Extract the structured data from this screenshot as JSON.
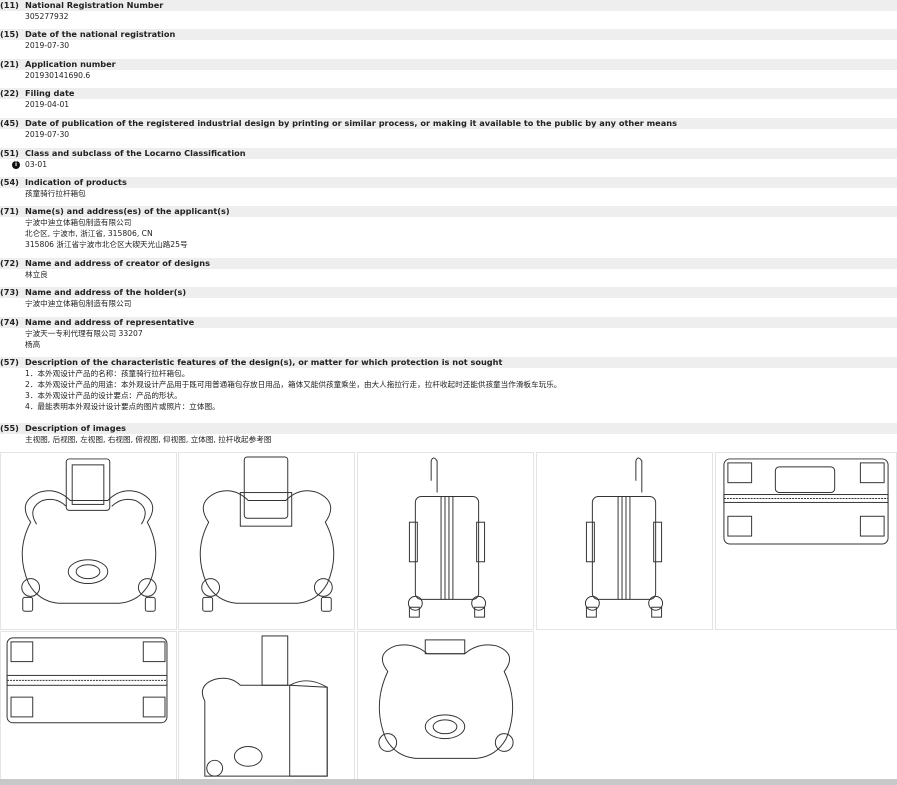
{
  "records": [
    {
      "code": "(11)",
      "label": "National Registration Number",
      "values": [
        "305277932"
      ]
    },
    {
      "code": "(15)",
      "label": "Date of the national registration",
      "values": [
        "2019-07-30"
      ]
    },
    {
      "code": "(21)",
      "label": "Application number",
      "values": [
        "201930141690.6"
      ]
    },
    {
      "code": "(22)",
      "label": "Filing date",
      "values": [
        "2019-04-01"
      ]
    },
    {
      "code": "(45)",
      "label": "Date of publication of the registered industrial design by printing or similar process, or making it available to the public by any other means",
      "values": [
        "2019-07-30"
      ]
    },
    {
      "code": "(51)",
      "label": "Class and subclass of the Locarno Classification",
      "values": [
        "03-01"
      ],
      "icon": "info-icon",
      "icon_glyph": "i"
    },
    {
      "code": "(54)",
      "label": "Indication of products",
      "values": [
        "孩童骑行拉杆箱包"
      ]
    },
    {
      "code": "(71)",
      "label": "Name(s) and address(es) of the applicant(s)",
      "values": [
        "宁波中迪立体箱包制造有限公司",
        "北仑区, 宁波市, 浙江省, 315806, CN",
        "315806 浙江省宁波市北仑区大碶天光山路25号"
      ]
    },
    {
      "code": "(72)",
      "label": "Name and address of creator of designs",
      "values": [
        "林立良"
      ]
    },
    {
      "code": "(73)",
      "label": "Name and address of the holder(s)",
      "values": [
        "宁波中迪立体箱包制造有限公司"
      ]
    },
    {
      "code": "(74)",
      "label": "Name and address of representative",
      "values": [
        "宁波天一专利代理有限公司 33207",
        "杨高"
      ]
    },
    {
      "code": "(57)",
      "label": "Description of the characteristic features of the design(s), or matter for which protection is not sought",
      "values": [
        "1．本外观设计产品的名称：孩童骑行拉杆箱包。",
        "2．本外观设计产品的用途：本外观设计产品用于既可用普通箱包存放日用品，箱体又能供孩童乘坐，由大人拖拉行走，拉杆收起时还能供孩童当作滑板车玩乐。",
        "3．本外观设计产品的设计要点：产品的形状。",
        "4．最能表明本外观设计设计要点的图片或照片：立体图。"
      ]
    },
    {
      "code": "(55)",
      "label": "Description of images",
      "values": [
        "主视图, 后视图, 左视图, 右视图, 俯视图, 仰视图, 立体图, 拉杆收起参考图"
      ]
    }
  ],
  "gallery": {
    "images": [
      {
        "name": "front-view-image",
        "view": "front"
      },
      {
        "name": "rear-view-image",
        "view": "rear"
      },
      {
        "name": "left-view-image",
        "view": "side"
      },
      {
        "name": "right-view-image",
        "view": "side"
      },
      {
        "name": "top-view-image",
        "view": "top"
      },
      {
        "name": "bottom-view-image",
        "view": "bottom"
      },
      {
        "name": "perspective-view-image",
        "view": "perspective"
      },
      {
        "name": "handle-retracted-reference-image",
        "view": "retracted"
      }
    ]
  }
}
